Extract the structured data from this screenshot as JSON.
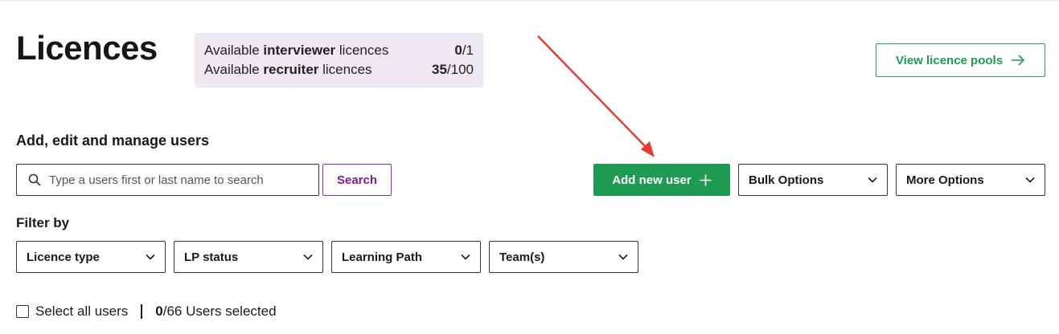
{
  "page": {
    "title": "Licences"
  },
  "licences": {
    "interviewer": {
      "prefix": "Available ",
      "type": "interviewer",
      "suffix": " licences",
      "used": "0",
      "total": "/1"
    },
    "recruiter": {
      "prefix": "Available ",
      "type": "recruiter",
      "suffix": " licences",
      "used": "35",
      "total": "/100"
    }
  },
  "header": {
    "view_pools_label": "View licence pools"
  },
  "manage": {
    "section_title": "Add, edit and manage users",
    "search_placeholder": "Type a users first or last name to search",
    "search_button": "Search",
    "add_user_label": "Add new user",
    "bulk_options_label": "Bulk Options",
    "more_options_label": "More Options"
  },
  "filters": {
    "title": "Filter by",
    "items": [
      {
        "label": "Licence type"
      },
      {
        "label": "LP status"
      },
      {
        "label": "Learning Path"
      },
      {
        "label": "Team(s)"
      }
    ]
  },
  "selection": {
    "select_all_label": "Select all users",
    "selected_count": "0",
    "selected_suffix": "/66 Users selected"
  },
  "colors": {
    "brand_green": "#1f9a52",
    "brand_purple": "#7b1e93",
    "licence_bg": "#efe8f2",
    "annotation_arrow": "#e8392e"
  },
  "icons": {
    "search": "search-icon",
    "arrow_right": "arrow-right-icon",
    "plus": "plus-icon",
    "chevron": "chevron-down-icon"
  }
}
